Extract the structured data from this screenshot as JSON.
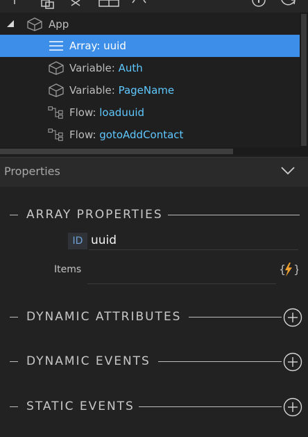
{
  "toolbar": {
    "icons": [
      "add-icon",
      "copy-icon",
      "scissors-icon",
      "box-icon",
      "code-icon",
      "info-icon",
      "refresh-icon"
    ]
  },
  "tree": {
    "root": {
      "label": "App",
      "icon": "cube-icon"
    },
    "items": [
      {
        "type": "Array:",
        "name": "uuid",
        "icon": "array-icon",
        "selected": true
      },
      {
        "type": "Variable:",
        "name": "Auth",
        "icon": "cube-icon",
        "selected": false
      },
      {
        "type": "Variable:",
        "name": "PageName",
        "icon": "cube-icon",
        "selected": false
      },
      {
        "type": "Flow:",
        "name": "loaduuid",
        "icon": "flow-icon",
        "selected": false
      },
      {
        "type": "Flow:",
        "name": "gotoAddContact",
        "icon": "flow-icon",
        "selected": false
      }
    ]
  },
  "properties": {
    "title": "Properties",
    "array_section": "ARRAY PROPERTIES",
    "id_badge": "ID",
    "id_value": "uuid",
    "items_label": "Items",
    "sections": [
      "DYNAMIC ATTRIBUTES",
      "DYNAMIC EVENTS",
      "STATIC EVENTS"
    ]
  },
  "colors": {
    "selection": "#3d8ee8",
    "value_text": "#5fc8ff",
    "accent_orange": "#f0a030"
  }
}
